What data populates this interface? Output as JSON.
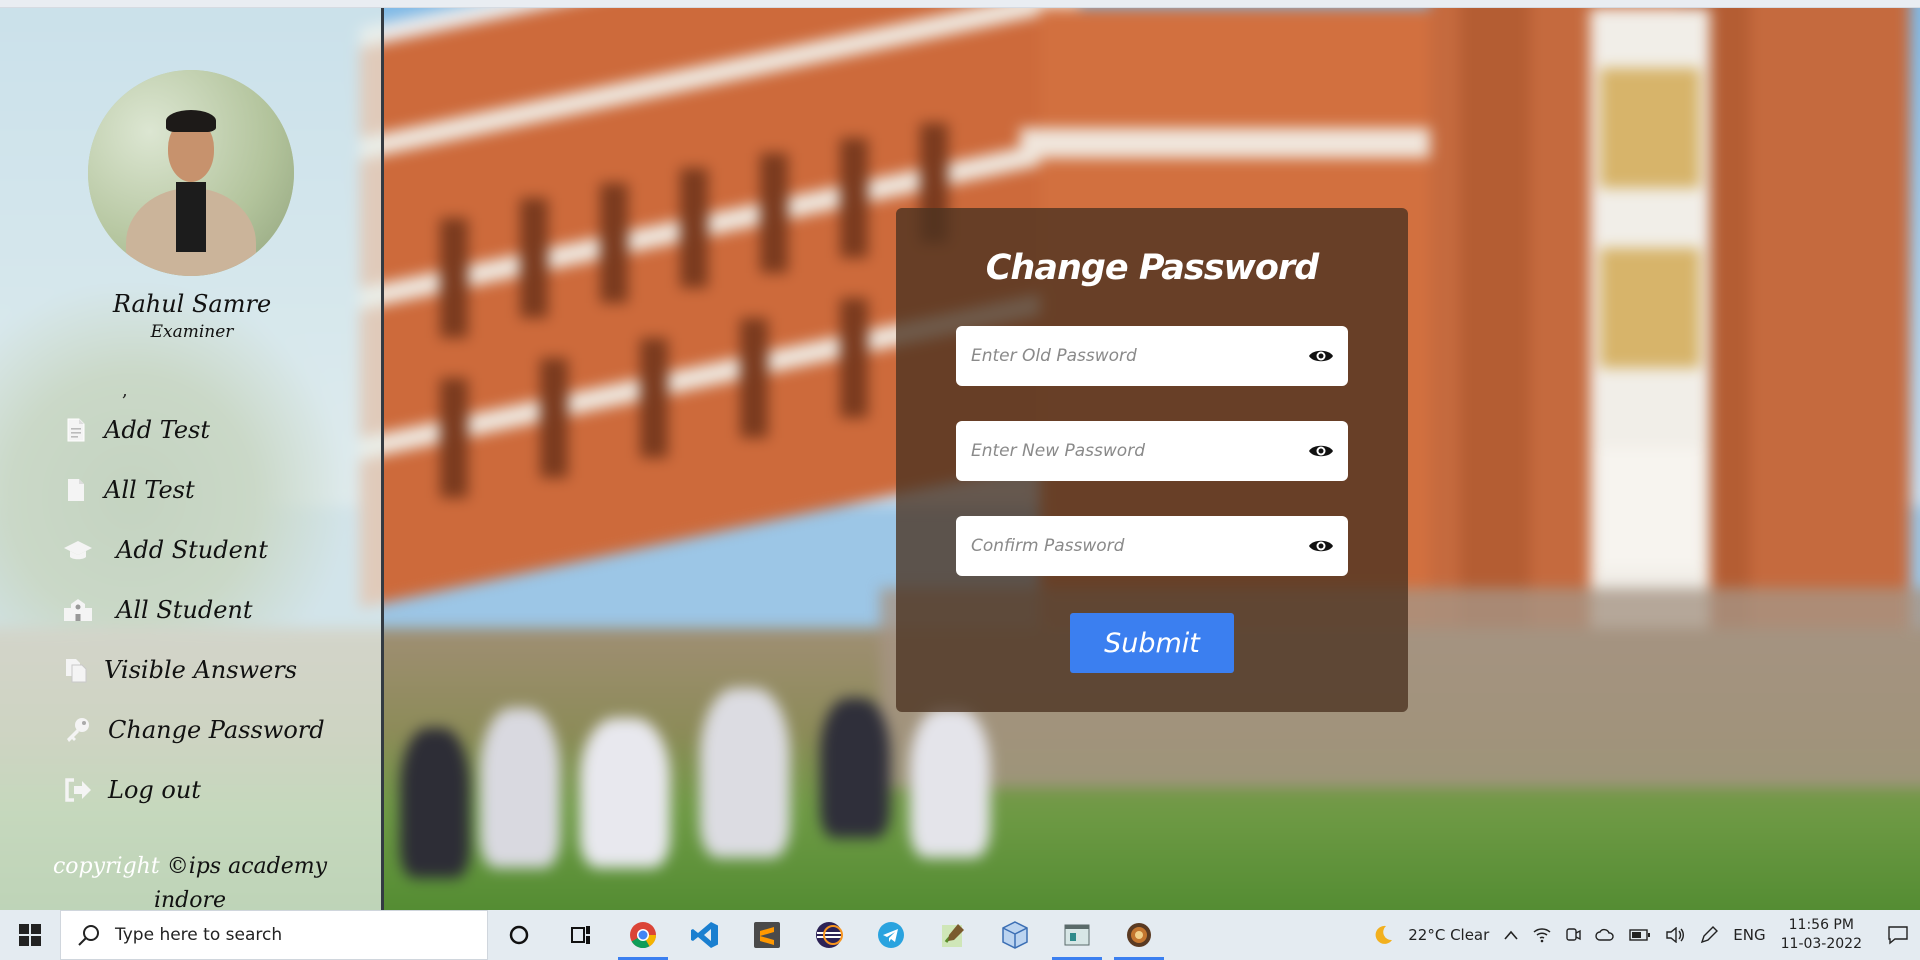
{
  "sidebar": {
    "user_name": "Rahul Samre",
    "user_role": "Examiner",
    "separator": ",",
    "nav": [
      {
        "label": "Add Test",
        "icon": "document-text-icon"
      },
      {
        "label": "All Test",
        "icon": "document-icon"
      },
      {
        "label": "Add Student",
        "icon": "graduation-cap-icon"
      },
      {
        "label": "All Student",
        "icon": "school-building-icon"
      },
      {
        "label": "Visible Answers",
        "icon": "copy-files-icon"
      },
      {
        "label": "Change Password",
        "icon": "key-icon"
      },
      {
        "label": "Log out",
        "icon": "sign-out-icon"
      }
    ],
    "copyright_prefix": "copyright",
    "copyright_text": "©ips academy indore"
  },
  "form": {
    "title": "Change Password",
    "old_password_placeholder": "Enter Old Password",
    "new_password_placeholder": "Enter New Password",
    "confirm_password_placeholder": "Confirm Password",
    "submit_label": "Submit"
  },
  "taskbar": {
    "search_placeholder": "Type here to search",
    "apps": [
      "cortana-icon",
      "task-view-icon",
      "chrome-icon",
      "vscode-icon",
      "sublime-icon",
      "eclipse-icon",
      "telegram-icon",
      "notepad-icon",
      "virtualbox-icon",
      "terminal-icon",
      "app-icon"
    ],
    "weather": "22°C  Clear",
    "language": "ENG",
    "time": "11:56 PM",
    "date": "11-03-2022"
  },
  "colors": {
    "accent": "#3b7ff0",
    "card_bg": "#4a3220"
  }
}
